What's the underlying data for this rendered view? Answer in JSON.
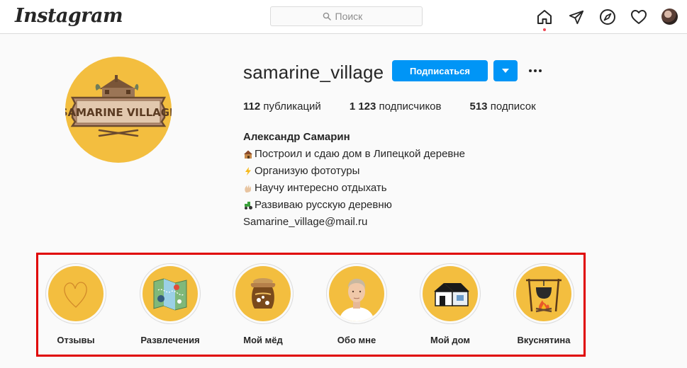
{
  "nav": {
    "logo": "Instagram",
    "search_placeholder": "Поиск",
    "icons": [
      "home-icon",
      "direct-icon",
      "explore-icon",
      "activity-heart-icon",
      "profile-avatar"
    ]
  },
  "profile": {
    "username": "samarine_village",
    "follow_label": "Подписаться",
    "logo_text": "SAMARINE VILLAGE",
    "stats": [
      {
        "count": "112",
        "label": "публикаций"
      },
      {
        "count": "1 123",
        "label": "подписчиков"
      },
      {
        "count": "513",
        "label": "подписок"
      }
    ],
    "full_name": "Александр Самарин",
    "bio_lines": [
      {
        "emoji": "house",
        "text": "Построил и сдаю дом в Липецкой деревне"
      },
      {
        "emoji": "lightning",
        "text": "Организую фототуры"
      },
      {
        "emoji": "hand",
        "text": "Научу интересно отдыхать"
      },
      {
        "emoji": "tractor",
        "text": "Развиваю русскую деревню"
      }
    ],
    "email": "Samarine_village@mail.ru"
  },
  "highlights": [
    {
      "label": "Отзывы",
      "icon": "heart-outline"
    },
    {
      "label": "Развлечения",
      "icon": "map"
    },
    {
      "label": "Мой мёд",
      "icon": "honey-jar"
    },
    {
      "label": "Обо мне",
      "icon": "man-portrait"
    },
    {
      "label": "Мой дом",
      "icon": "house"
    },
    {
      "label": "Вкуснятина",
      "icon": "campfire-pot"
    }
  ],
  "colors": {
    "accent": "#0095f6",
    "highlight_bg": "#f3be3f",
    "frame": "#e00000",
    "notification_dot": "#ed4956"
  }
}
